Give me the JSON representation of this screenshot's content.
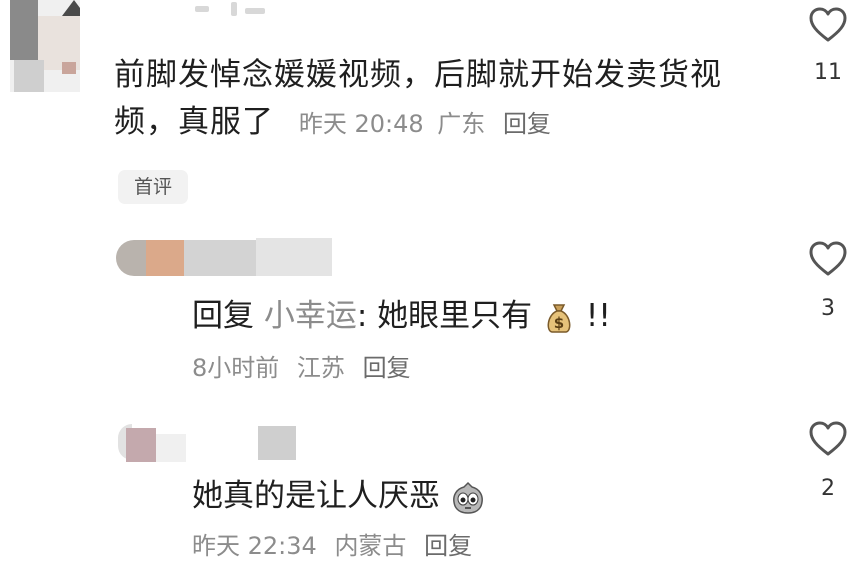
{
  "comments": [
    {
      "text_line1": "前脚发悼念媛媛视频，后脚就开始发卖货视",
      "text_line2": "频，真服了",
      "time": "昨天 20:48",
      "location": "广东",
      "reply_label": "回复",
      "badge": "首评",
      "likes": "11"
    },
    {
      "reply_prefix": "回复",
      "reply_to": "小幸运",
      "text": ": 她眼里只有",
      "emoji": "money-bag-emoji",
      "suffix": " !!",
      "time": "8小时前",
      "location": "江苏",
      "reply_label": "回复",
      "likes": "3"
    },
    {
      "text": "她真的是让人厌恶",
      "emoji": "angry-face-emoji",
      "time": "昨天 22:34",
      "location": "内蒙古",
      "reply_label": "回复",
      "likes": "2"
    }
  ],
  "colors": {
    "text": "#1f1f1f",
    "meta": "#8c8c8c",
    "heart": "#555555"
  }
}
